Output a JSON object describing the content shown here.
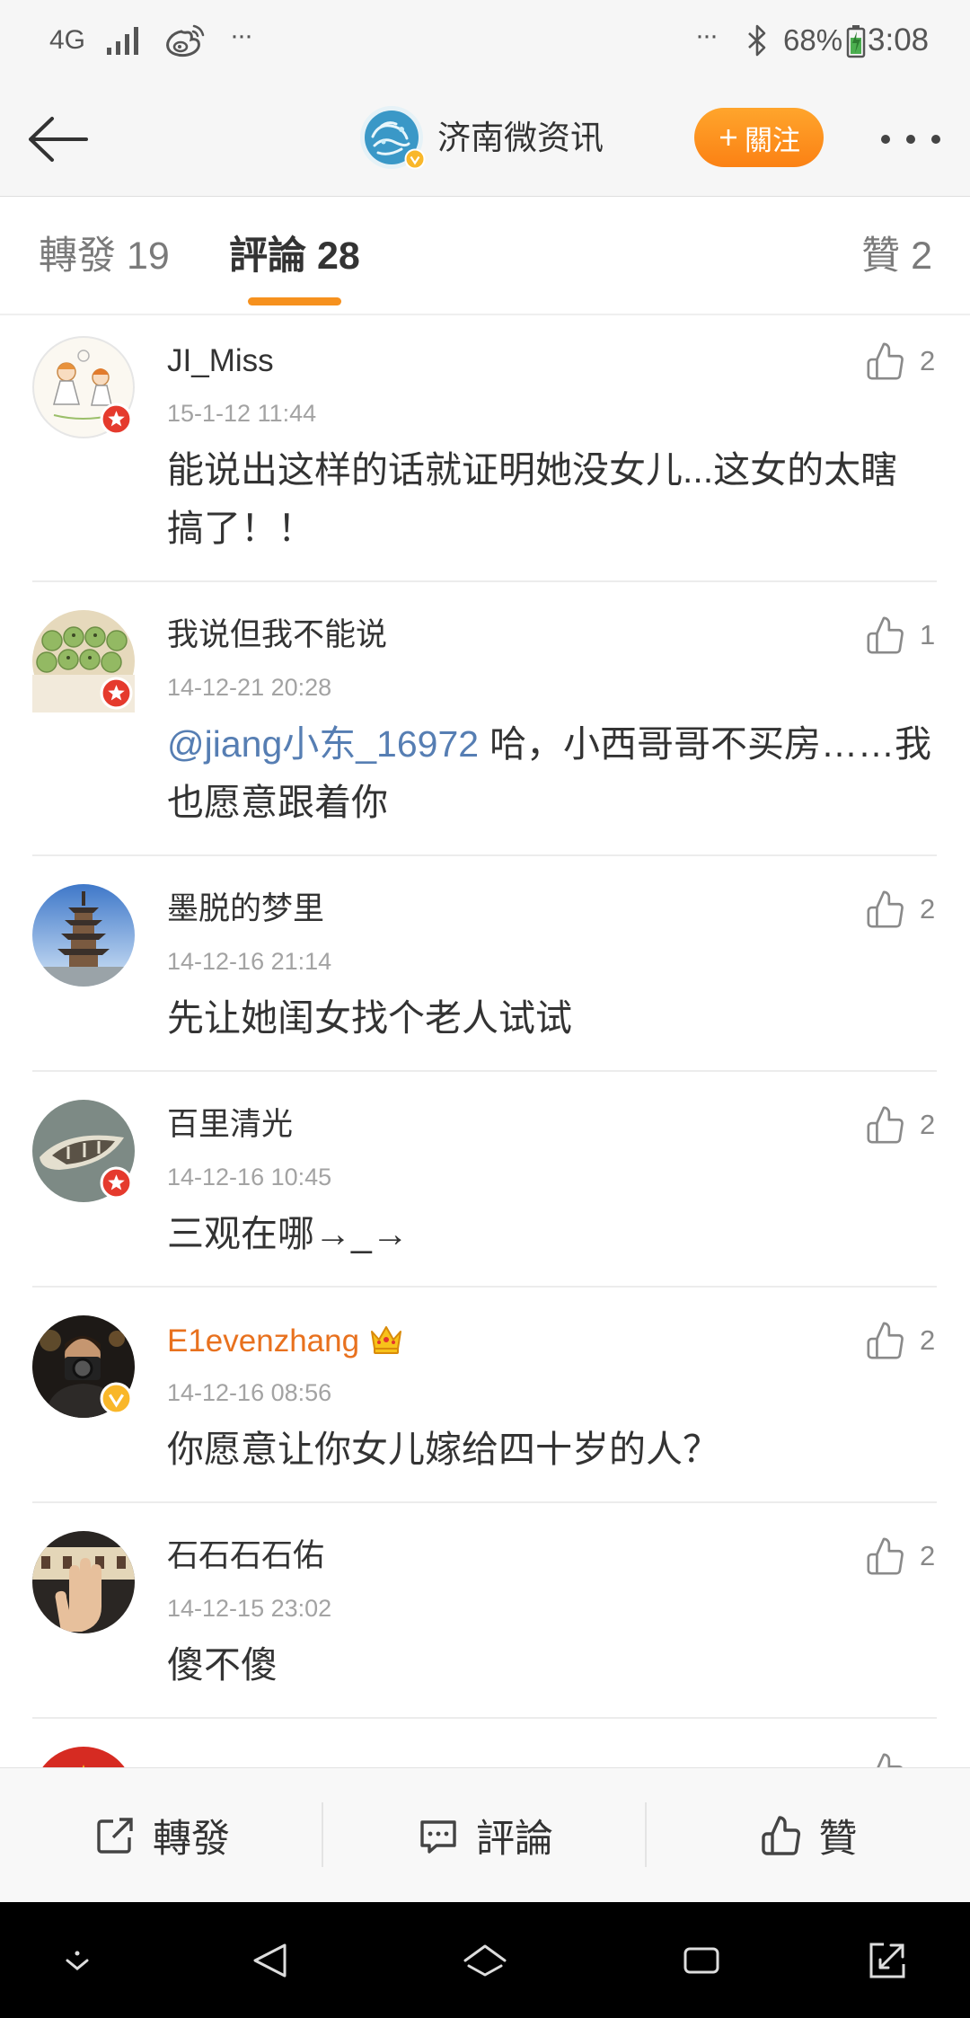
{
  "status_bar": {
    "network": "4G",
    "overflow_left": "···",
    "overflow_right": "···",
    "battery": "68%",
    "time": "3:08"
  },
  "header": {
    "title": "济南微资讯",
    "follow_label": "關注",
    "follow_icon": "plus-icon"
  },
  "tabs": [
    {
      "label": "轉發",
      "count": "19"
    },
    {
      "label": "評論",
      "count": "28"
    },
    {
      "label": "贊",
      "count": "2"
    }
  ],
  "active_tab": "評論",
  "comments": [
    {
      "name": "JI_Miss",
      "date": "15-1-12 11:44",
      "text": "能说出这样的话就证明她没女儿...这女的太瞎搞了！！",
      "likes": "2",
      "avatar": "cartoon-couple",
      "badge": "member-badge"
    },
    {
      "name": "我说但我不能说",
      "date": "14-12-21 20:28",
      "mention": "@jiang小东_16972",
      "text": "哈，小西哥哥不买房……我也愿意跟着你",
      "likes": "1",
      "avatar": "food-photo",
      "badge": "member-badge"
    },
    {
      "name": "墨脱的梦里",
      "date": "14-12-16 21:14",
      "text": "先让她闺女找个老人试试",
      "likes": "2",
      "avatar": "pagoda-photo"
    },
    {
      "name": "百里清光",
      "date": "14-12-16 10:45",
      "text": "三观在哪→_→",
      "likes": "2",
      "avatar": "boat-photo",
      "badge": "member-badge"
    },
    {
      "name": "E1evenzhang",
      "name_color": "#e8711e",
      "crown": "crown-icon",
      "date": "14-12-16 08:56",
      "text": "你愿意让你女儿嫁给四十岁的人？",
      "likes": "2",
      "avatar": "camera-photo",
      "badge": "verified-badge"
    },
    {
      "name": "石石石石佑",
      "date": "14-12-15 23:02",
      "text": "傻不傻",
      "likes": "2",
      "avatar": "hand-photo"
    }
  ],
  "bottom_bar": {
    "repost_label": "轉發",
    "comment_label": "評論",
    "like_label": "贊"
  },
  "colors": {
    "accent": "#f6911e",
    "follow_button": "#fb8114",
    "mention": "#567eb3",
    "member_badge": "#e53a2d",
    "verified_badge": "#f9b72a"
  }
}
